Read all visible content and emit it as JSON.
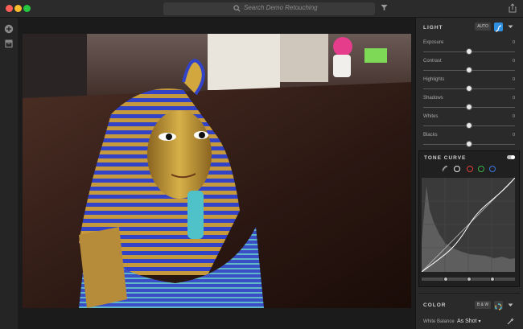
{
  "search": {
    "placeholder": "Search Demo Retouching"
  },
  "colors": {
    "accent": "#2f8fe0",
    "close": "#fc5f57",
    "min": "#fdbc2e",
    "max": "#27c840"
  },
  "light": {
    "title": "LIGHT",
    "auto_label": "AUTO",
    "sliders": [
      {
        "label": "Exposure",
        "value": "0",
        "level": 0.5
      },
      {
        "label": "Contrast",
        "value": "0",
        "level": 0.5
      },
      {
        "label": "Highlights",
        "value": "0",
        "level": 0.5
      },
      {
        "label": "Shadows",
        "value": "0",
        "level": 0.5
      },
      {
        "label": "Whites",
        "value": "0",
        "level": 0.5
      },
      {
        "label": "Blacks",
        "value": "0",
        "level": 0.5
      }
    ]
  },
  "tone_curve": {
    "title": "TONE CURVE",
    "channels": [
      "point-curve-icon",
      "white-channel",
      "red-channel",
      "green-channel",
      "blue-channel"
    ]
  },
  "color": {
    "title": "COLOR",
    "bw_label": "B & W",
    "white_balance_label": "White Balance",
    "white_balance_value": "As Shot"
  }
}
